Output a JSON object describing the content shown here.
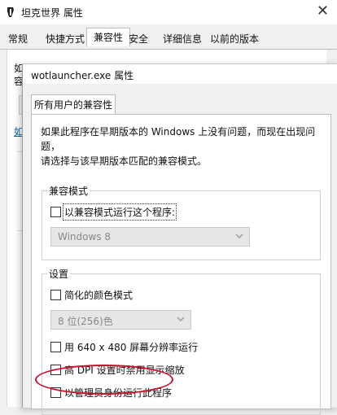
{
  "background_window": {
    "title": "坦克世界 属性",
    "close_glyph": "✕",
    "tabs": [
      {
        "label": "常规",
        "active": false
      },
      {
        "label": "快捷方式",
        "active": false
      },
      {
        "label": "兼容性",
        "active": true
      },
      {
        "label": "安全",
        "active": false
      },
      {
        "label": "详细信息",
        "active": false
      },
      {
        "label": "以前的版本",
        "active": false
      }
    ],
    "fragments": {
      "line1": "如",
      "line2": "容",
      "link": "如"
    }
  },
  "dialog": {
    "title": "wotlauncher.exe 属性",
    "tab": "所有用户的兼容性",
    "description_line1": "如果此程序在早期版本的 Windows 上没有问题，而现在出现问题，",
    "description_line2": "请选择与该早期版本匹配的兼容模式。",
    "compat_group": {
      "title": "兼容模式",
      "checkbox_label": "以兼容模式运行这个程序:",
      "checked": false,
      "select_value": "Windows 8"
    },
    "settings_group": {
      "title": "设置",
      "reduced_color": {
        "label": "简化的颜色模式",
        "checked": false
      },
      "color_select_value": "8 位(256)色",
      "run_640": {
        "label": "用 640 x 480 屏幕分辨率运行",
        "checked": false
      },
      "disable_dpi": {
        "label": "高 DPI 设置时禁用显示缩放",
        "checked": false
      },
      "run_as_admin": {
        "label": "以管理员身份运行此程序",
        "checked": false
      }
    }
  },
  "colors": {
    "annotation_oval": "#c8102e",
    "link": "#0063b1"
  }
}
